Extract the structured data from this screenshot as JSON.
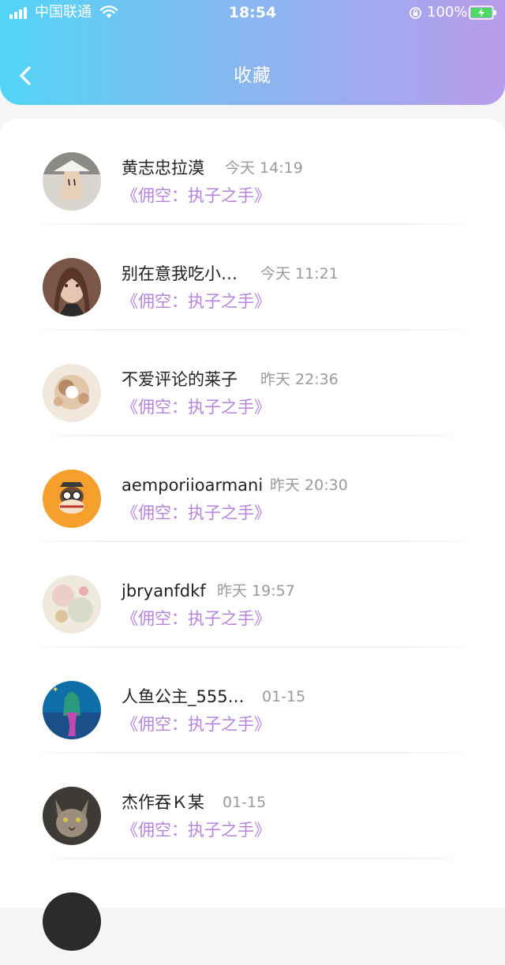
{
  "status_bar": {
    "carrier": "中国联通",
    "time": "18:54",
    "battery": "100%"
  },
  "header": {
    "title": "收藏"
  },
  "favorites": [
    {
      "name": "黄志忠拉漠",
      "time": "今天 14:19",
      "work": "《佣空：执子之手》"
    },
    {
      "name": "别在意我吃小…",
      "time": "今天 11:21",
      "work": "《佣空：执子之手》"
    },
    {
      "name": "不爱评论的莱子",
      "time": "昨天 22:36",
      "work": "《佣空：执子之手》"
    },
    {
      "name": "aemporiioarmani",
      "time": "昨天 20:30",
      "work": "《佣空：执子之手》"
    },
    {
      "name": "jbryanfdkf",
      "time": "昨天 19:57",
      "work": "《佣空：执子之手》"
    },
    {
      "name": "人鱼公主_555…",
      "time": "01-15",
      "work": "《佣空：执子之手》"
    },
    {
      "name": "杰作吞Ｋ某",
      "time": "01-15",
      "work": "《佣空：执子之手》"
    }
  ],
  "colors": {
    "header_gradient_start": "#52d4f6",
    "header_gradient_end": "#b99cec",
    "work_title": "#b684dd",
    "timestamp": "#9a9a9a"
  }
}
